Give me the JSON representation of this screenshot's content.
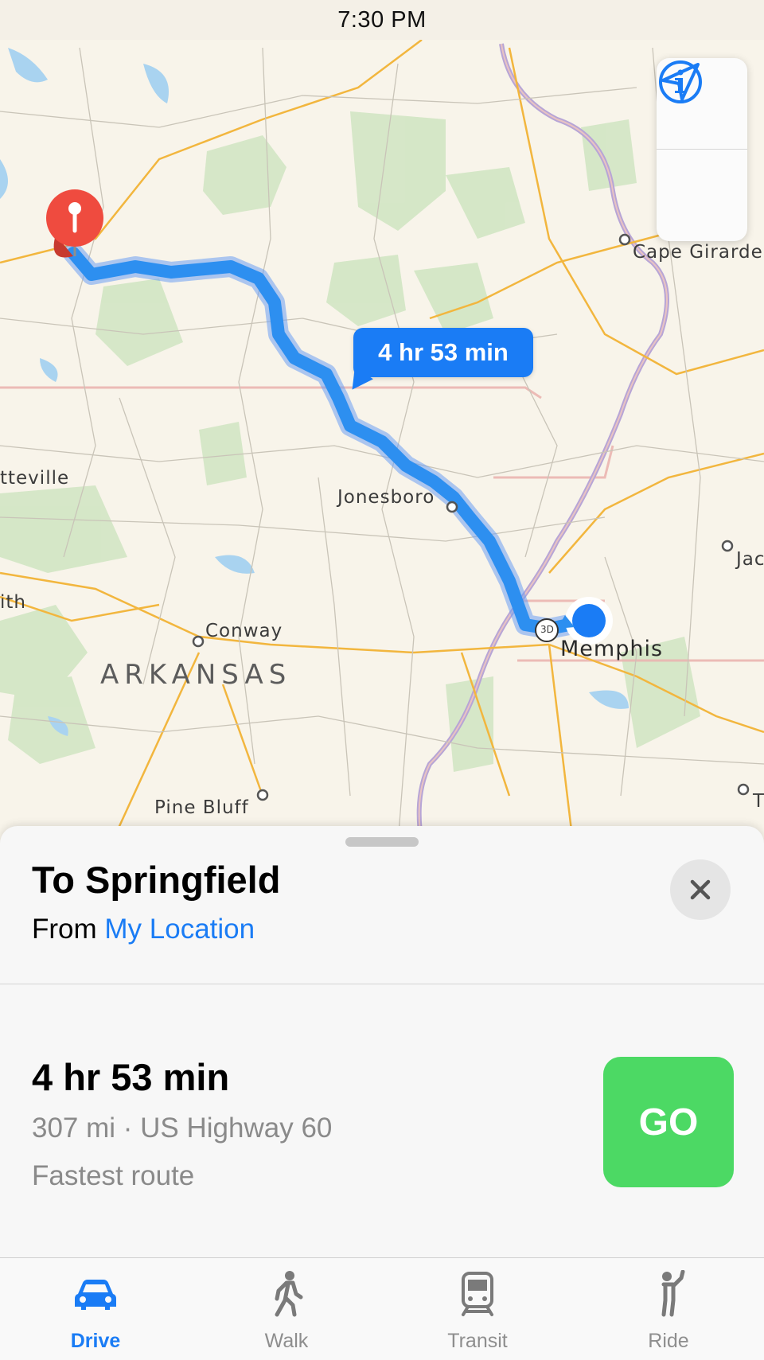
{
  "status_bar": {
    "time": "7:30 PM"
  },
  "map": {
    "labels": {
      "cape_girardeau": "Cape Girarde",
      "fayetteville": "tteville",
      "jonesboro": "Jonesboro",
      "jackson": "Jac",
      "smith": "ith",
      "conway": "Conway",
      "arkansas": "ARKANSAS",
      "memphis": "Memphis",
      "pine_bluff": "Pine Bluff",
      "tupelo": "T",
      "interstate_shield": "3D"
    },
    "eta_bubble": "4 hr 53 min",
    "controls": [
      "info-icon",
      "location-arrow-icon"
    ],
    "colors": {
      "route": "#1a7cf5",
      "pin": "#ef4b3f",
      "user_dot": "#1a7cf5"
    }
  },
  "sheet": {
    "destination": "To Springfield",
    "from_prefix": "From",
    "from_location": "My Location",
    "close_icon": "close-icon"
  },
  "route": {
    "duration": "4 hr 53 min",
    "detail": "307 mi · US Highway 60",
    "note": "Fastest route",
    "go_label": "GO",
    "go_color": "#4cd964"
  },
  "tabs": [
    {
      "label": "Drive",
      "icon": "car-icon",
      "active": true
    },
    {
      "label": "Walk",
      "icon": "walk-icon",
      "active": false
    },
    {
      "label": "Transit",
      "icon": "train-icon",
      "active": false
    },
    {
      "label": "Ride",
      "icon": "ride-icon",
      "active": false
    }
  ]
}
